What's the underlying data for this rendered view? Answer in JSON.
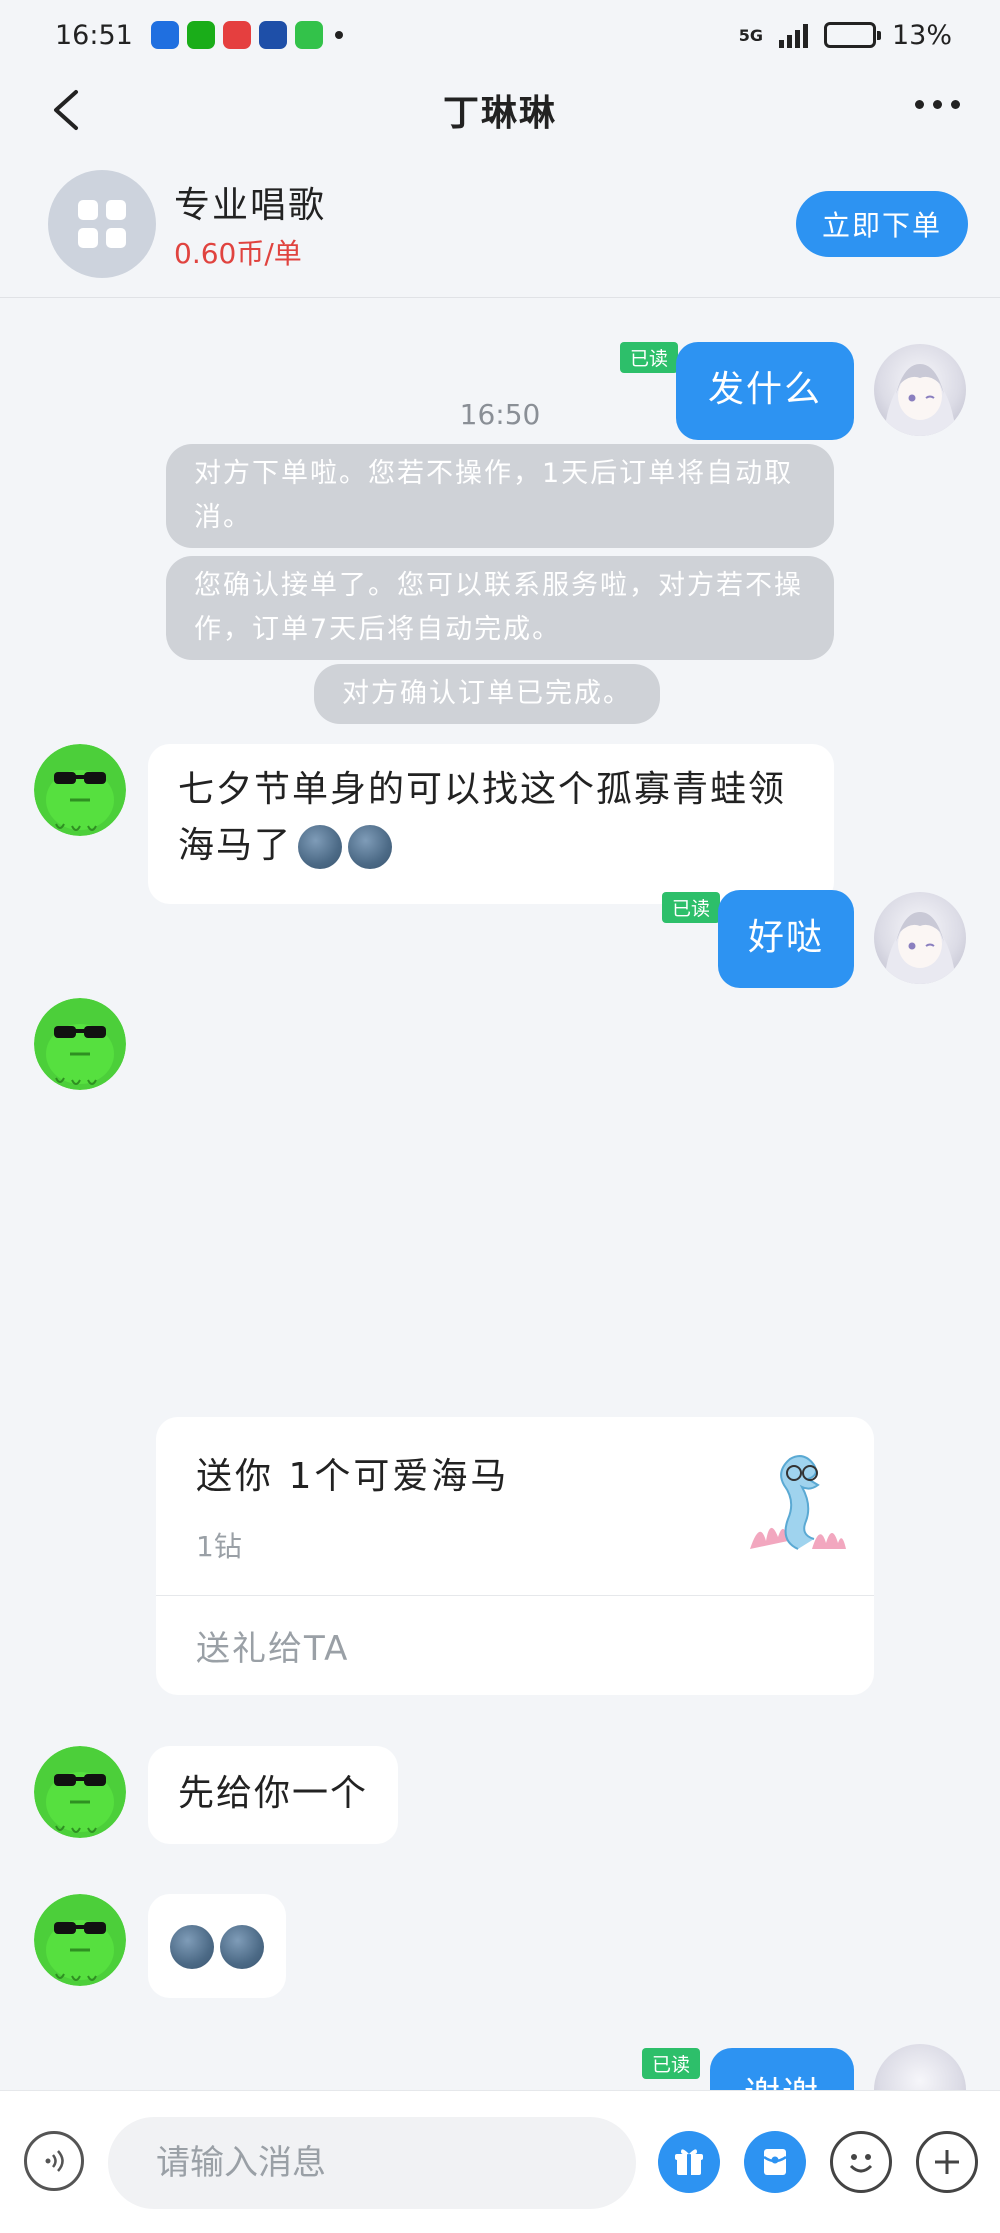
{
  "status_bar": {
    "time": "16:51",
    "network": "5G",
    "battery": "13%",
    "battery_level": 0.13,
    "app_icon_colors": [
      "#1f6fe0",
      "#1aad19",
      "#e53f3f",
      "#1e4fa8",
      "#33c24a"
    ]
  },
  "navbar": {
    "title": "丁琳琳",
    "back_icon": "chevron-left-icon",
    "more_icon": "more-horizontal-icon"
  },
  "service": {
    "name": "专业唱歌",
    "price": "0.60币/单",
    "order_button": "立即下单",
    "icon": "apps-grid-icon"
  },
  "messages": {
    "timestamp": "16:50",
    "read_label": "已读",
    "msg1": "发什么",
    "sys1": "对方下单啦。您若不操作，1天后订单将自动取消。",
    "sys2": "您确认接单了。您可以联系服务啦，对方若不操作，订单7天后将自动完成。",
    "sys3": "对方确认订单已完成。",
    "msg2": "七夕节单身的可以找这个孤寡青蛙领海马了",
    "msg3": "好哒",
    "gift": {
      "title": "送你 1个可爱海马",
      "price": "1钻",
      "action": "送礼给TA",
      "icon": "seahorse-icon"
    },
    "msg4": "先给你一个",
    "msg5_emoji": "moon-emoji-icon",
    "msg6": "谢谢"
  },
  "input_bar": {
    "placeholder": "请输入消息",
    "icons": [
      "voice-icon",
      "gift-icon",
      "red-packet-icon",
      "emoji-icon",
      "plus-icon"
    ]
  },
  "colors": {
    "accent": "#2d93f2",
    "read_badge": "#2dbf6a",
    "price": "#e0433f",
    "background": "#f3f5f8"
  }
}
